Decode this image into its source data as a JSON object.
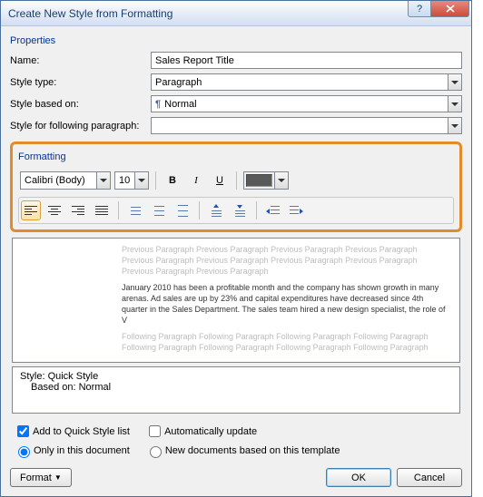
{
  "dialog": {
    "title": "Create New Style from Formatting"
  },
  "section_properties": "Properties",
  "fields": {
    "name_label": "Name:",
    "name_value": "Sales Report Title",
    "type_label": "Style type:",
    "type_value": "Paragraph",
    "based_label": "Style based on:",
    "based_value": "Normal",
    "follow_label": "Style for following paragraph:",
    "follow_value": ""
  },
  "section_formatting": "Formatting",
  "toolbar": {
    "font": "Calibri (Body)",
    "size": "10",
    "bold": "B",
    "italic": "I",
    "underline": "U",
    "color": "#595959"
  },
  "preview": {
    "grey1": "Previous Paragraph Previous Paragraph Previous Paragraph Previous Paragraph Previous Paragraph Previous Paragraph Previous Paragraph Previous Paragraph Previous Paragraph Previous Paragraph",
    "body": "January 2010 has been a profitable month and the company has shown growth in many arenas. Ad sales are up by 23% and capital expenditures have decreased since 4th quarter in the Sales Department. The sales team hired a new design specialist, the role of V",
    "grey2": "Following Paragraph Following Paragraph Following Paragraph Following Paragraph Following Paragraph Following Paragraph Following Paragraph Following Paragraph"
  },
  "stylebox": {
    "line1": "Style: Quick Style",
    "line2": "Based on: Normal"
  },
  "opts": {
    "quick": "Add to Quick Style list",
    "auto": "Automatically update",
    "only": "Only in this document",
    "tmpl": "New documents based on this template"
  },
  "buttons": {
    "format": "Format",
    "ok": "OK",
    "cancel": "Cancel"
  }
}
